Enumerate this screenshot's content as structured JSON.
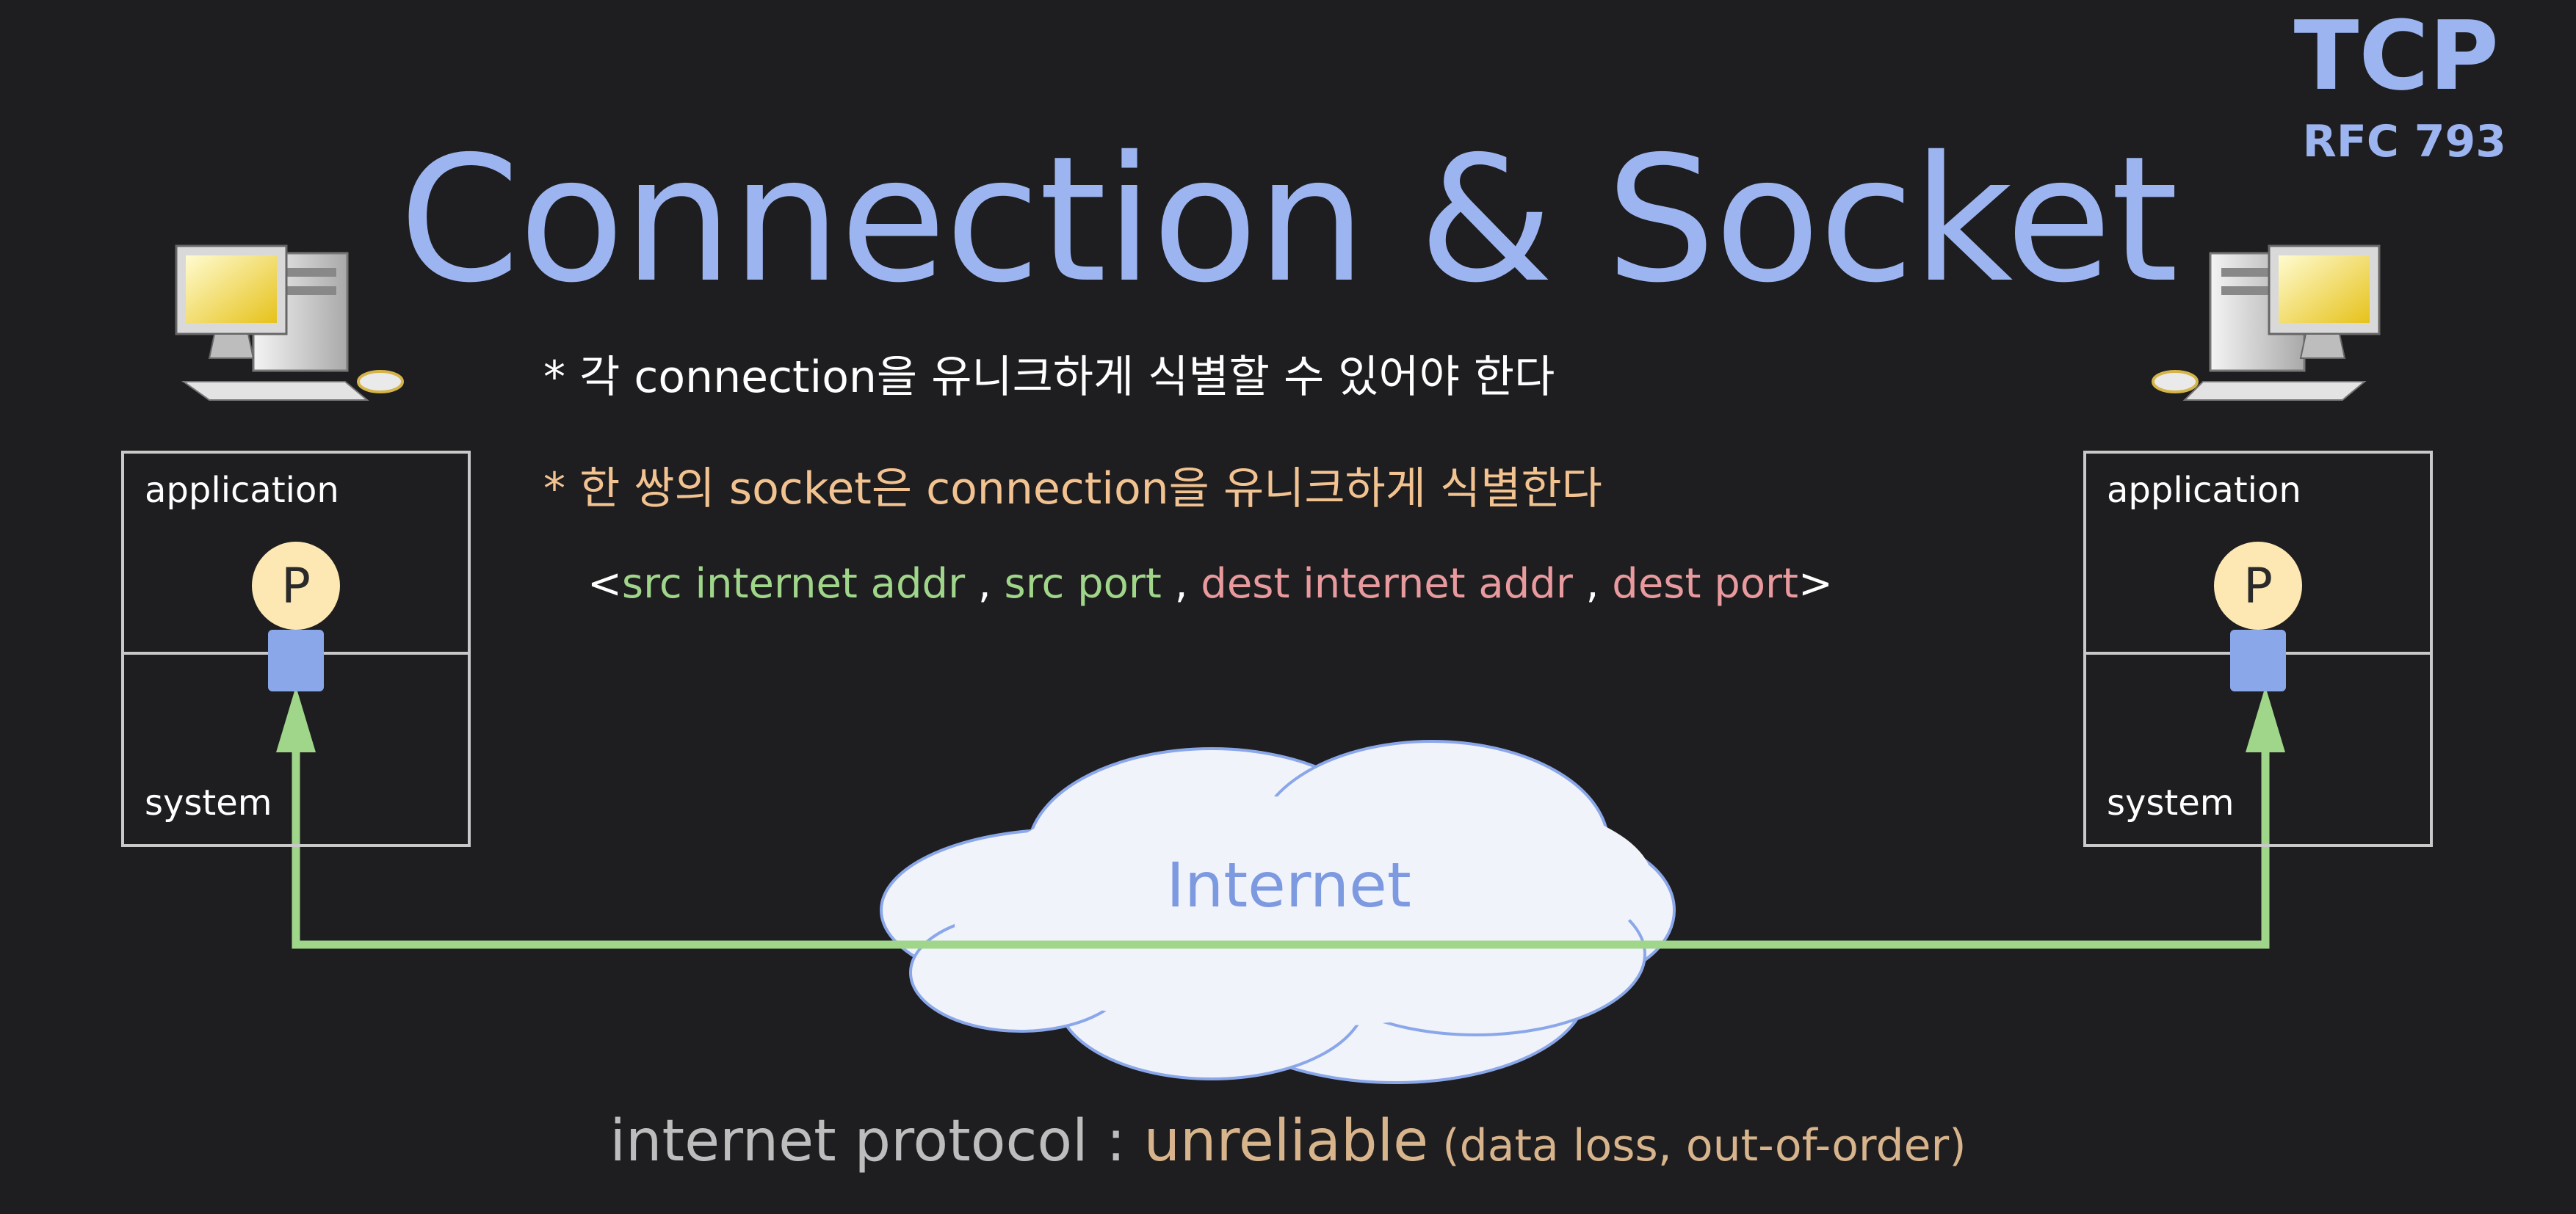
{
  "header": {
    "title": "Connection & Socket",
    "protocol": "TCP",
    "rfc": "RFC 793"
  },
  "bullets": [
    "* 각 connection을 유니크하게 식별할 수 있어야 한다",
    "* 한 쌍의 socket은 connection을 유니크하게 식별한다"
  ],
  "tuple": {
    "open": "<",
    "src_addr": "src internet addr",
    "sep1": " , ",
    "src_port": "src port",
    "sep2": " , ",
    "dest_addr": "dest internet addr",
    "sep3": " , ",
    "dest_port": "dest port",
    "close": ">"
  },
  "hosts": {
    "left": {
      "app_label": "application",
      "sys_label": "system",
      "process": "P"
    },
    "right": {
      "app_label": "application",
      "sys_label": "system",
      "process": "P"
    }
  },
  "cloud": {
    "label": "Internet"
  },
  "footer": {
    "prefix": "internet protocol : ",
    "emphasis": "unreliable",
    "detail": " (data loss, out-of-order)"
  },
  "colors": {
    "title": "#9cb4f0",
    "bullet_highlight": "#f2c391",
    "tuple_src": "#9fd68a",
    "tuple_dest": "#e99a9e",
    "link": "#9fd68a",
    "socket": "#8aa7ea",
    "process": "#fde8b4"
  }
}
